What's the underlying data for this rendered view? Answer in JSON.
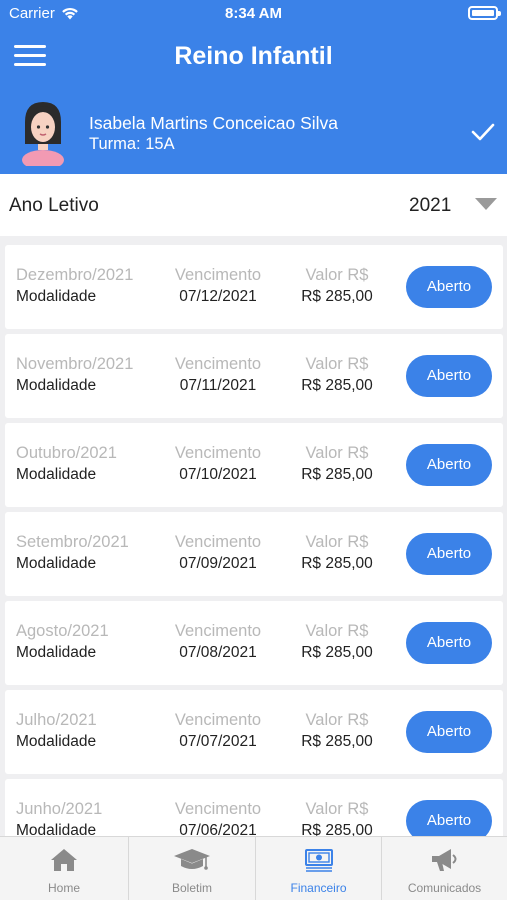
{
  "status_bar": {
    "carrier": "Carrier",
    "time": "8:34 AM"
  },
  "app": {
    "title": "Reino Infantil"
  },
  "student": {
    "name": "Isabela Martins Conceicao Silva",
    "class": "Turma: 15A"
  },
  "filter": {
    "label": "Ano Letivo",
    "selected_year": "2021"
  },
  "invoice_headers": {
    "modality": "Modalidade",
    "due": "Vencimento",
    "amount": "Valor R$"
  },
  "invoices": [
    {
      "month": "Dezembro/2021",
      "due_date": "07/12/2021",
      "amount": "R$ 285,00",
      "status": "Aberto"
    },
    {
      "month": "Novembro/2021",
      "due_date": "07/11/2021",
      "amount": "R$ 285,00",
      "status": "Aberto"
    },
    {
      "month": "Outubro/2021",
      "due_date": "07/10/2021",
      "amount": "R$ 285,00",
      "status": "Aberto"
    },
    {
      "month": "Setembro/2021",
      "due_date": "07/09/2021",
      "amount": "R$ 285,00",
      "status": "Aberto"
    },
    {
      "month": "Agosto/2021",
      "due_date": "07/08/2021",
      "amount": "R$ 285,00",
      "status": "Aberto"
    },
    {
      "month": "Julho/2021",
      "due_date": "07/07/2021",
      "amount": "R$ 285,00",
      "status": "Aberto"
    },
    {
      "month": "Junho/2021",
      "due_date": "07/06/2021",
      "amount": "R$ 285,00",
      "status": "Aberto"
    }
  ],
  "tabs": [
    {
      "label": "Home",
      "icon": "home-icon",
      "active": false
    },
    {
      "label": "Boletim",
      "icon": "graduation-cap-icon",
      "active": false
    },
    {
      "label": "Financeiro",
      "icon": "money-icon",
      "active": true
    },
    {
      "label": "Comunicados",
      "icon": "megaphone-icon",
      "active": false
    }
  ],
  "colors": {
    "primary": "#3b82e8",
    "background": "#efeff1",
    "muted_text": "#b8b8b8",
    "inactive_tab": "#8a8a8a"
  }
}
